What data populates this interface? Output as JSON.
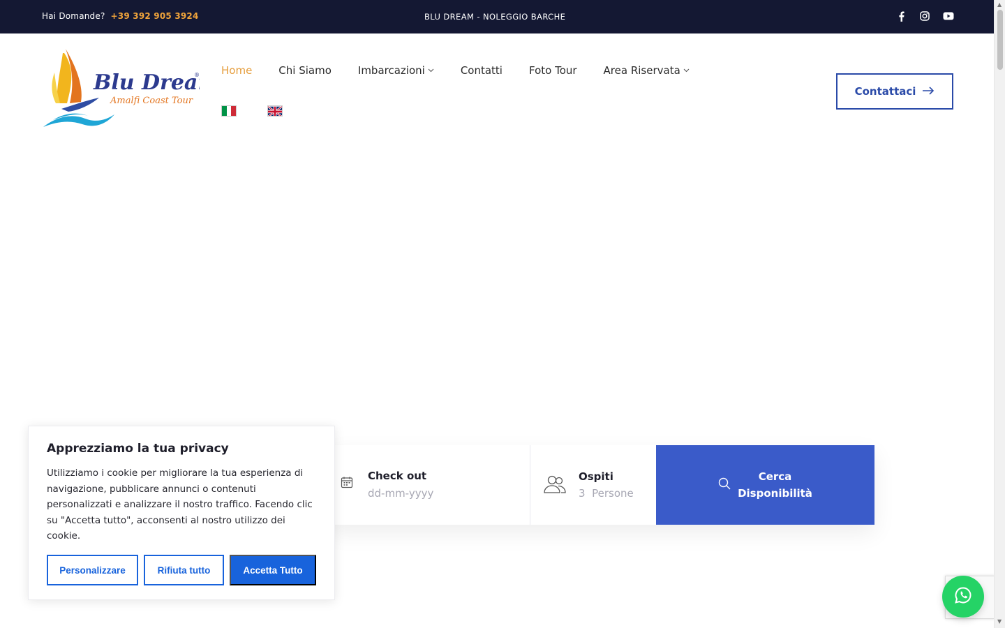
{
  "topbar": {
    "question": "Hai Domande?",
    "phone": "+39 392 905 3924",
    "center_text": "BLU DREAM - NOLEGGIO BARCHE",
    "social": [
      "facebook-icon",
      "instagram-icon",
      "youtube-icon"
    ]
  },
  "logo": {
    "name": "Blu Dream",
    "tagline": "Amalfi Coast Tour"
  },
  "nav": {
    "items": [
      {
        "label": "Home"
      },
      {
        "label": "Chi Siamo"
      },
      {
        "label": "Imbarcazioni"
      },
      {
        "label": "Contatti"
      },
      {
        "label": "Foto Tour"
      },
      {
        "label": "Area Riservata"
      }
    ],
    "languages": [
      "italian-flag-icon",
      "uk-flag-icon"
    ]
  },
  "header": {
    "contact_label": "Contattaci"
  },
  "booking": {
    "checkout_label": "Check out",
    "checkout_placeholder": "dd-mm-yyyy",
    "guests_label": "Ospiti",
    "guests_count": "3",
    "guests_unit": "Persone",
    "search_label_line1": "Cerca",
    "search_label_line2": "Disponibilità"
  },
  "cookie": {
    "title": "Apprezziamo la tua privacy",
    "body": "Utilizziamo i cookie per migliorare la tua esperienza di navigazione, pubblicare annunci o contenuti personalizzati e analizzare il nostro traffico. Facendo clic su \"Accetta tutto\", acconsenti al nostro utilizzo dei cookie.",
    "customize": "Personalizzare",
    "reject": "Rifiuta tutto",
    "accept": "Accetta Tutto"
  },
  "colors": {
    "topbar_bg": "#141833",
    "phone": "#f1a43b",
    "nav_active": "#e59c3a",
    "brand_blue": "#2a4aa8",
    "search_bg": "#3a5bc9",
    "cookie_blue": "#1863dc",
    "whatsapp": "#25d366"
  }
}
